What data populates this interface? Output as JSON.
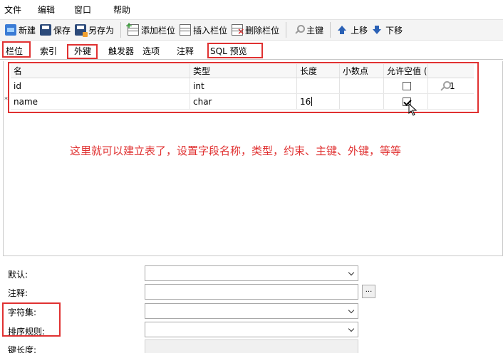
{
  "menu": [
    "文件",
    "编辑",
    "窗口",
    "帮助"
  ],
  "toolbar": {
    "new_label": "新建",
    "save_label": "保存",
    "saveas_label": "另存为",
    "add_field_label": "添加栏位",
    "insert_field_label": "插入栏位",
    "delete_field_label": "删除栏位",
    "primary_key_label": "主键",
    "move_up_label": "上移",
    "move_down_label": "下移"
  },
  "tabs": [
    "栏位",
    "索引",
    "外键",
    "触发器",
    "选项",
    "注释",
    "SQL 预览"
  ],
  "table": {
    "headers": [
      "名",
      "类型",
      "长度",
      "小数点",
      "允许空值 (",
      ""
    ],
    "rows": [
      {
        "name": "id",
        "type": "int",
        "length": "",
        "decimals": "",
        "allow_null": false,
        "key": "1"
      },
      {
        "name": "name",
        "type": "char",
        "length": "16",
        "decimals": "",
        "allow_null": true,
        "key": ""
      }
    ]
  },
  "annotation": "这里就可以建立表了，设置字段名称，类型，约束、主键、外键，等等",
  "properties": {
    "default_label": "默认:",
    "comment_label": "注释:",
    "charset_label": "字符集:",
    "collation_label": "排序规则:",
    "key_length_label": "键长度:",
    "dots_label": "..."
  },
  "colors": {
    "annotation": "#e03131",
    "highlight_box": "#e03131",
    "toolbar_bg": "#f4f4f4"
  }
}
